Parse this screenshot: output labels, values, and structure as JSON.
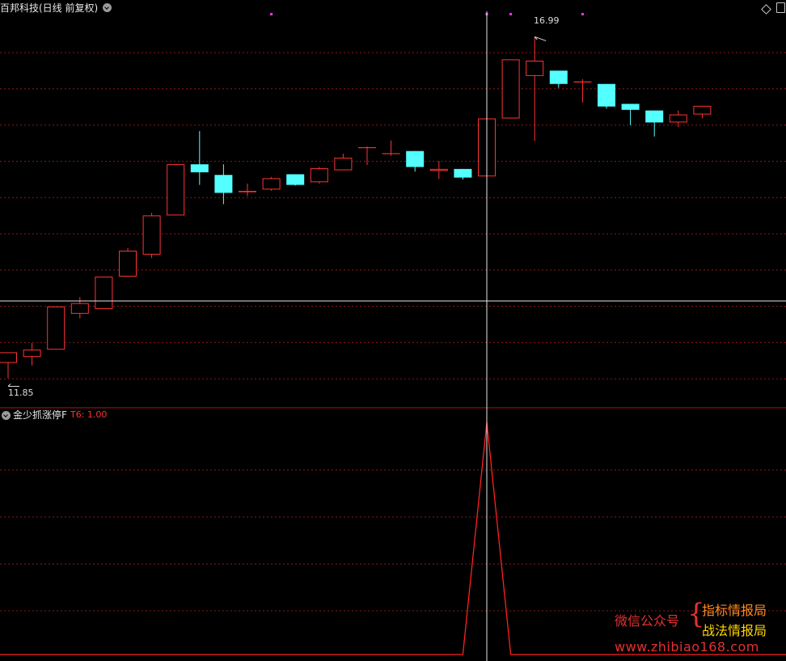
{
  "main_panel": {
    "title": "百邦科技(日线 前复权)",
    "high_label": "16.99",
    "low_label": "11.85"
  },
  "indicator_panel": {
    "title": "金少抓涨停F",
    "value_label": "T6: 1.00"
  },
  "watermark": {
    "left_text": "微信公众号",
    "brace": "{",
    "right_line1": "指标情报局",
    "right_line2": "战法情报局",
    "url": "www.zhibiao168.com"
  },
  "colors": {
    "background": "#000000",
    "up": "#ff3232",
    "down": "#54ffff",
    "grid": "#8a1a1a",
    "crosshair": "#e6e6e6",
    "signal_marker": "#ff33ff",
    "indicator_line": "#ff2020"
  },
  "icons": [
    "chevron-down-icon",
    "diamond-icon",
    "window-icon",
    "price-arrow-icon"
  ],
  "chart_data": [
    {
      "type": "candlestick",
      "title": "百邦科技(日线 前复权)",
      "ylim": [
        11.6,
        17.3
      ],
      "annotations": {
        "high": 16.99,
        "low": 11.85
      },
      "candles": [
        {
          "o": 12.08,
          "h": 12.23,
          "l": 11.85,
          "c": 12.24
        },
        {
          "o": 12.17,
          "h": 12.38,
          "l": 12.04,
          "c": 12.28
        },
        {
          "o": 12.28,
          "h": 12.93,
          "l": 12.28,
          "c": 12.93
        },
        {
          "o": 12.82,
          "h": 13.07,
          "l": 12.75,
          "c": 12.98
        },
        {
          "o": 12.89,
          "h": 13.38,
          "l": 12.89,
          "c": 13.38
        },
        {
          "o": 13.38,
          "h": 13.81,
          "l": 13.38,
          "c": 13.77
        },
        {
          "o": 13.71,
          "h": 14.34,
          "l": 13.66,
          "c": 14.3
        },
        {
          "o": 14.3,
          "h": 15.07,
          "l": 14.3,
          "c": 15.07
        },
        {
          "o": 15.07,
          "h": 15.57,
          "l": 14.76,
          "c": 14.95
        },
        {
          "o": 14.91,
          "h": 15.07,
          "l": 14.47,
          "c": 14.64
        },
        {
          "o": 14.65,
          "h": 14.78,
          "l": 14.59,
          "c": 14.67
        },
        {
          "o": 14.69,
          "h": 14.88,
          "l": 14.67,
          "c": 14.86
        },
        {
          "o": 14.92,
          "h": 14.92,
          "l": 14.75,
          "c": 14.76
        },
        {
          "o": 14.8,
          "h": 15.03,
          "l": 14.78,
          "c": 15.01
        },
        {
          "o": 14.98,
          "h": 15.23,
          "l": 14.98,
          "c": 15.17
        },
        {
          "o": 15.32,
          "h": 15.34,
          "l": 15.06,
          "c": 15.32
        },
        {
          "o": 15.23,
          "h": 15.43,
          "l": 15.2,
          "c": 15.23
        },
        {
          "o": 15.27,
          "h": 15.27,
          "l": 14.96,
          "c": 15.03
        },
        {
          "o": 14.97,
          "h": 15.12,
          "l": 14.85,
          "c": 15.0
        },
        {
          "o": 15.0,
          "h": 15.0,
          "l": 14.84,
          "c": 14.87
        },
        {
          "o": 14.89,
          "h": 15.69,
          "l": 14.63,
          "c": 15.76
        },
        {
          "o": 15.76,
          "h": 16.65,
          "l": 15.76,
          "c": 16.65
        },
        {
          "o": 16.4,
          "h": 16.99,
          "l": 15.42,
          "c": 16.63
        },
        {
          "o": 16.48,
          "h": 16.48,
          "l": 16.22,
          "c": 16.28
        },
        {
          "o": 16.3,
          "h": 16.35,
          "l": 16.0,
          "c": 16.31
        },
        {
          "o": 16.28,
          "h": 16.28,
          "l": 15.91,
          "c": 15.94
        },
        {
          "o": 15.98,
          "h": 15.98,
          "l": 15.66,
          "c": 15.89
        },
        {
          "o": 15.88,
          "h": 15.88,
          "l": 15.49,
          "c": 15.7
        },
        {
          "o": 15.7,
          "h": 15.88,
          "l": 15.63,
          "c": 15.82
        },
        {
          "o": 15.82,
          "h": 15.95,
          "l": 15.76,
          "c": 15.95
        }
      ],
      "signal_markers": [
        11,
        20,
        21,
        24
      ]
    },
    {
      "type": "line",
      "title": "金少抓涨停F",
      "series": [
        {
          "name": "T6",
          "values": [
            0,
            0,
            0,
            0,
            0,
            0,
            0,
            0,
            0,
            0,
            0,
            0,
            0,
            0,
            0,
            0,
            0,
            0,
            0,
            0,
            1,
            0,
            0,
            0,
            0,
            0,
            0,
            0,
            0,
            0
          ]
        }
      ],
      "ylim": [
        0,
        1
      ]
    }
  ]
}
